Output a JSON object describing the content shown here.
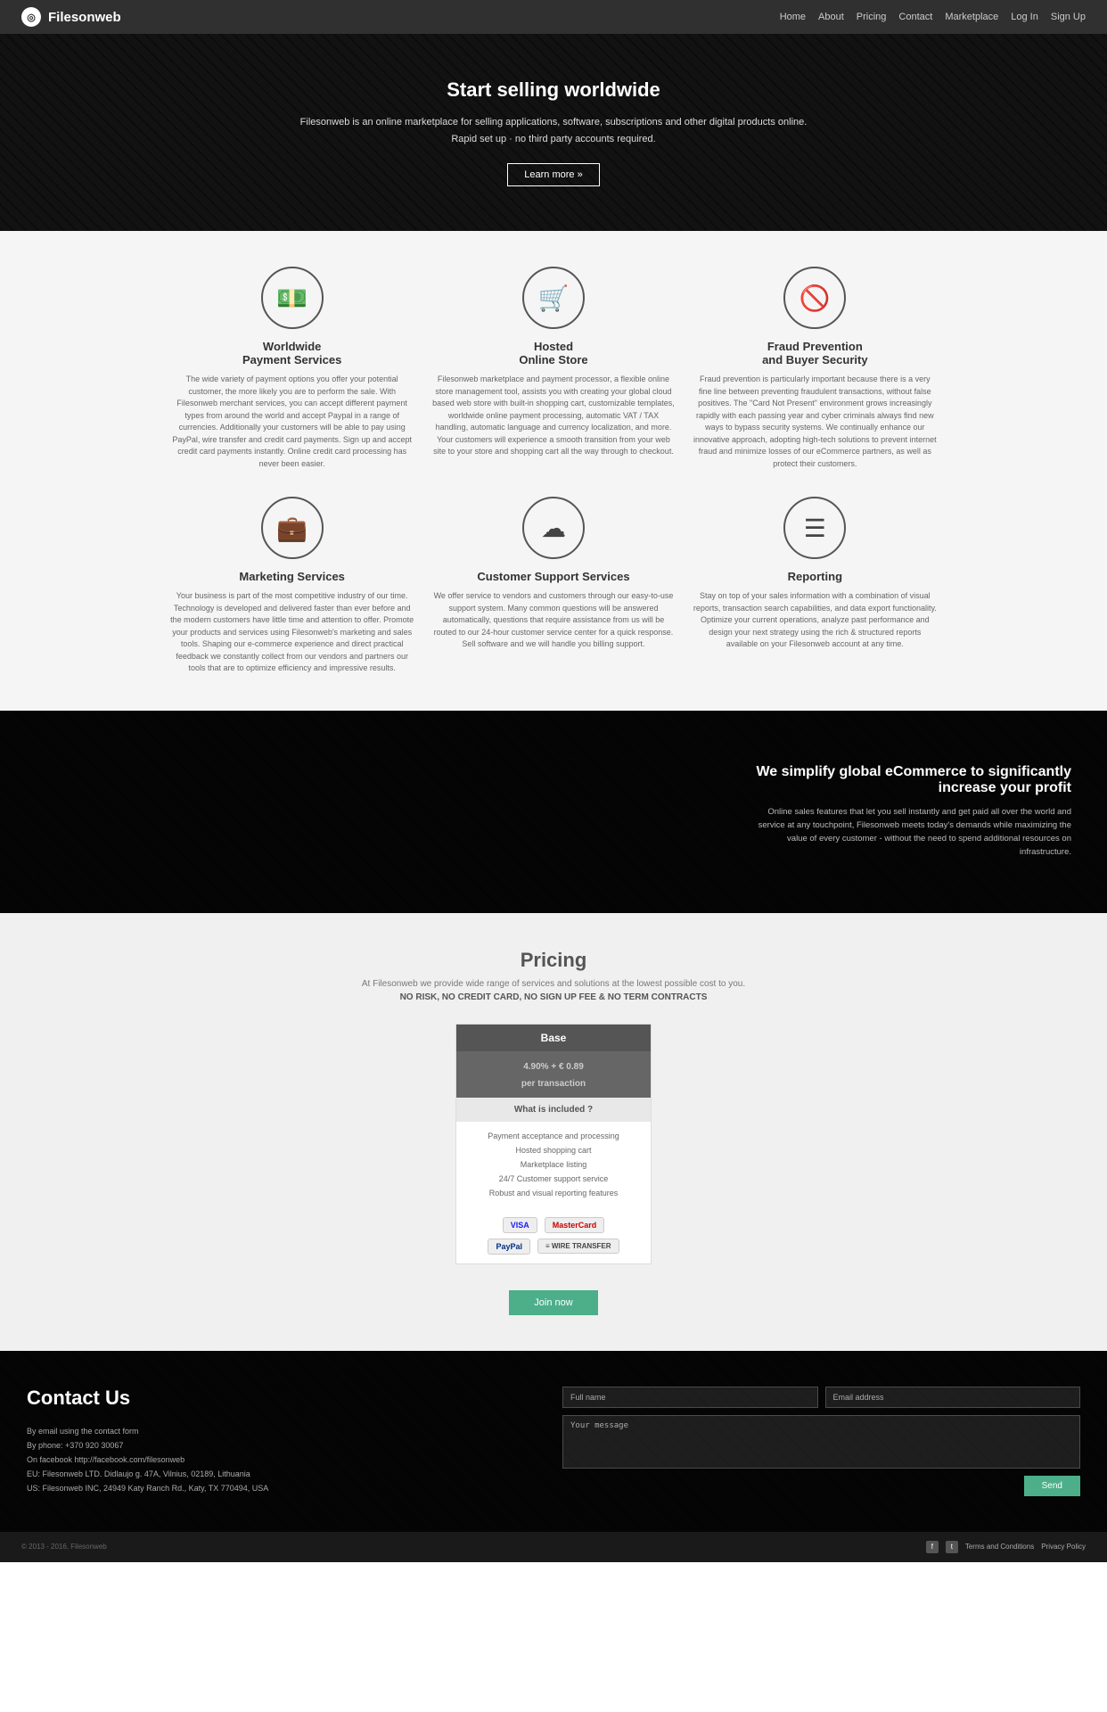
{
  "nav": {
    "logo": "Filesonweb",
    "links": [
      "Home",
      "About",
      "Pricing",
      "Contact",
      "Marketplace",
      "Log In",
      "Sign Up"
    ]
  },
  "hero": {
    "title": "Start selling worldwide",
    "line1": "Filesonweb is an online marketplace for selling applications, software, subscriptions and other digital products online.",
    "line2": "Rapid set up · no third party accounts required.",
    "cta": "Learn more »"
  },
  "features": [
    {
      "icon": "💵",
      "title": "Worldwide\nPayment Services",
      "desc": "The wide variety of payment options you offer your potential customer, the more likely you are to perform the sale. With Filesonweb merchant services, you can accept different payment types from around the world and accept Paypal in a range of currencies. Additionally your customers will be able to pay using PayPal, wire transfer and credit card payments. Sign up and accept credit card payments instantly. Online credit card processing has never been easier."
    },
    {
      "icon": "🛒",
      "title": "Hosted\nOnline Store",
      "desc": "Filesonweb marketplace and payment processor, a flexible online store management tool, assists you with creating your global cloud based web store with built-in shopping cart, customizable templates, worldwide online payment processing, automatic VAT / TAX handling, automatic language and currency localization, and more. Your customers will experience a smooth transition from your web site to your store and shopping cart all the way through to checkout."
    },
    {
      "icon": "🚫",
      "title": "Fraud Prevention\nand Buyer Security",
      "desc": "Fraud prevention is particularly important because there is a very fine line between preventing fraudulent transactions, without false positives. The \"Card Not Present\" environment grows increasingly rapidly with each passing year and cyber criminals always find new ways to bypass security systems. We continually enhance our innovative approach, adopting high-tech solutions to prevent internet fraud and minimize losses of our eCommerce partners, as well as protect their customers."
    },
    {
      "icon": "💼",
      "title": "Marketing Services",
      "desc": "Your business is part of the most competitive industry of our time. Technology is developed and delivered faster than ever before and the modern customers have little time and attention to offer. Promote your products and services using Filesonweb's marketing and sales tools. Shaping our e-commerce experience and direct practical feedback we constantly collect from our vendors and partners our tools that are to optimize efficiency and impressive results."
    },
    {
      "icon": "☁",
      "title": "Customer Support Services",
      "desc": "We offer service to vendors and customers through our easy-to-use support system. Many common questions will be answered automatically, questions that require assistance from us will be routed to our 24-hour customer service center for a quick response. Sell software and we will handle you billing support."
    },
    {
      "icon": "≡",
      "title": "Reporting",
      "desc": "Stay on top of your sales information with a combination of visual reports, transaction search capabilities, and data export functionality. Optimize your current operations, analyze past performance and design your next strategy using the rich & structured reports available on your Filesonweb account at any time."
    }
  ],
  "promo": {
    "title": "We simplify global eCommerce to significantly increase your profit",
    "desc": "Online sales features that let you sell instantly and get paid all over the world and service at any touchpoint, Filesonweb meets today's demands while maximizing the value of every customer - without the need to spend additional resources on infrastructure."
  },
  "pricing": {
    "title": "Pricing",
    "subtitle": "At Filesonweb we provide wide range of services and solutions at the lowest possible cost to you.",
    "note": "NO RISK, NO CREDIT CARD, NO SIGN UP FEE & NO TERM CONTRACTS",
    "card": {
      "tier": "Base",
      "price": "4.90% + € 0.89",
      "per": "per transaction",
      "what": "What is included ?",
      "items": [
        "Payment acceptance and processing",
        "Hosted shopping cart",
        "Marketplace listing",
        "24/7 Customer support service",
        "Robust and visual reporting features"
      ]
    },
    "join_label": "Join now",
    "payments": [
      {
        "label": "VISA",
        "class": "visa"
      },
      {
        "label": "MasterCard",
        "class": "mc"
      },
      {
        "label": "PayPal",
        "class": "paypal"
      },
      {
        "label": "≡WIRE TRANSFER",
        "class": "wire"
      }
    ]
  },
  "contact": {
    "title": "Contact Us",
    "info": [
      "By email using the contact form",
      "By phone: +370 920 30067",
      "On facebook http://facebook.com/filesonweb",
      "EU: Filesonweb LTD. Didlaujo g. 47A, Vilnius, 02189, Lithuania",
      "US: Filesonweb INC, 24949 Katy Ranch Rd., Katy, TX 770494, USA"
    ],
    "placeholders": {
      "full_name": "Full name",
      "email": "Email address",
      "message": "Your message"
    },
    "send_label": "Send"
  },
  "footer": {
    "copyright": "© 2013 - 2016, Filesonweb",
    "links": [
      "Terms and Conditions",
      "Privacy Policy"
    ]
  }
}
